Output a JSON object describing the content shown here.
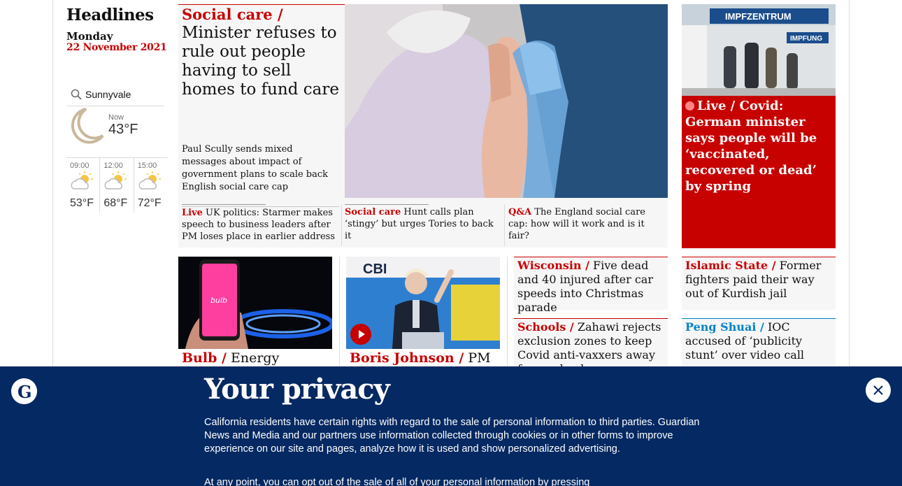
{
  "headlines": {
    "title": "Headlines",
    "day": "Monday",
    "date": "22 November 2021"
  },
  "weather": {
    "location": "Sunnyvale",
    "now_label": "Now",
    "now_temp": "43°F",
    "now_icon": "moon-icon",
    "forecast": [
      {
        "time": "09:00",
        "temp": "53°F",
        "icon": "sun-cloud-icon"
      },
      {
        "time": "12:00",
        "temp": "68°F",
        "icon": "sun-cloud-icon"
      },
      {
        "time": "15:00",
        "temp": "72°F",
        "icon": "sun-cloud-icon"
      }
    ]
  },
  "lead": {
    "kicker": "Social care /",
    "headline": "Minister refuses to rule out people having to sell homes to fund care",
    "standfirst": "Paul Scully sends mixed messages about impact of government plans to scale back English social care cap",
    "sublinks": [
      {
        "kicker": "Live",
        "text": "UK politics: Starmer makes speech to business leaders after PM loses place in earlier address"
      },
      {
        "kicker": "Social care",
        "text": "Hunt calls plan ‘stingy’ but urges Tories to back it"
      },
      {
        "kicker": "Q&A",
        "text": "The England social care cap: how will it work and is it fair?"
      }
    ]
  },
  "live_card": {
    "kicker": "Live /",
    "headline": "Covid: German minister says people will be ‘vaccinated, recovered or dead’ by spring",
    "image_sign": "IMPFZENTRUM",
    "image_sign2": "IMPFUNG"
  },
  "row2": {
    "bulb": {
      "kicker": "Bulb /",
      "headline": "Energy supplier",
      "image_text": "bulb"
    },
    "boris": {
      "kicker": "Boris Johnson /",
      "headline": "PM",
      "image_text": "CBI"
    },
    "cards": [
      {
        "kicker": "Wisconsin /",
        "headline": "Five dead and 40 injured after car speeds into Christmas parade"
      },
      {
        "kicker": "Islamic State /",
        "headline": "Former fighters paid their way out of Kurdish jail"
      },
      {
        "kicker": "Schools /",
        "headline": "Zahawi rejects exclusion zones to keep Covid anti-vaxxers away from schools"
      },
      {
        "kicker": "Peng Shuai /",
        "headline": "IOC accused of ‘publicity stunt’ over video call"
      }
    ]
  },
  "privacy": {
    "title": "Your privacy",
    "body": "California residents have certain rights with regard to the sale of personal information to third parties. Guardian News and Media and our partners use information collected through cookies or in other forms to improve experience on our site and pages, analyze how it is used and show personalized advertising.",
    "body2": "At any point, you can opt out of the sale of all of your personal information by pressing",
    "colors": {
      "banner": "#052962",
      "accent": "#c70000",
      "link_blue": "#0084c6"
    }
  }
}
